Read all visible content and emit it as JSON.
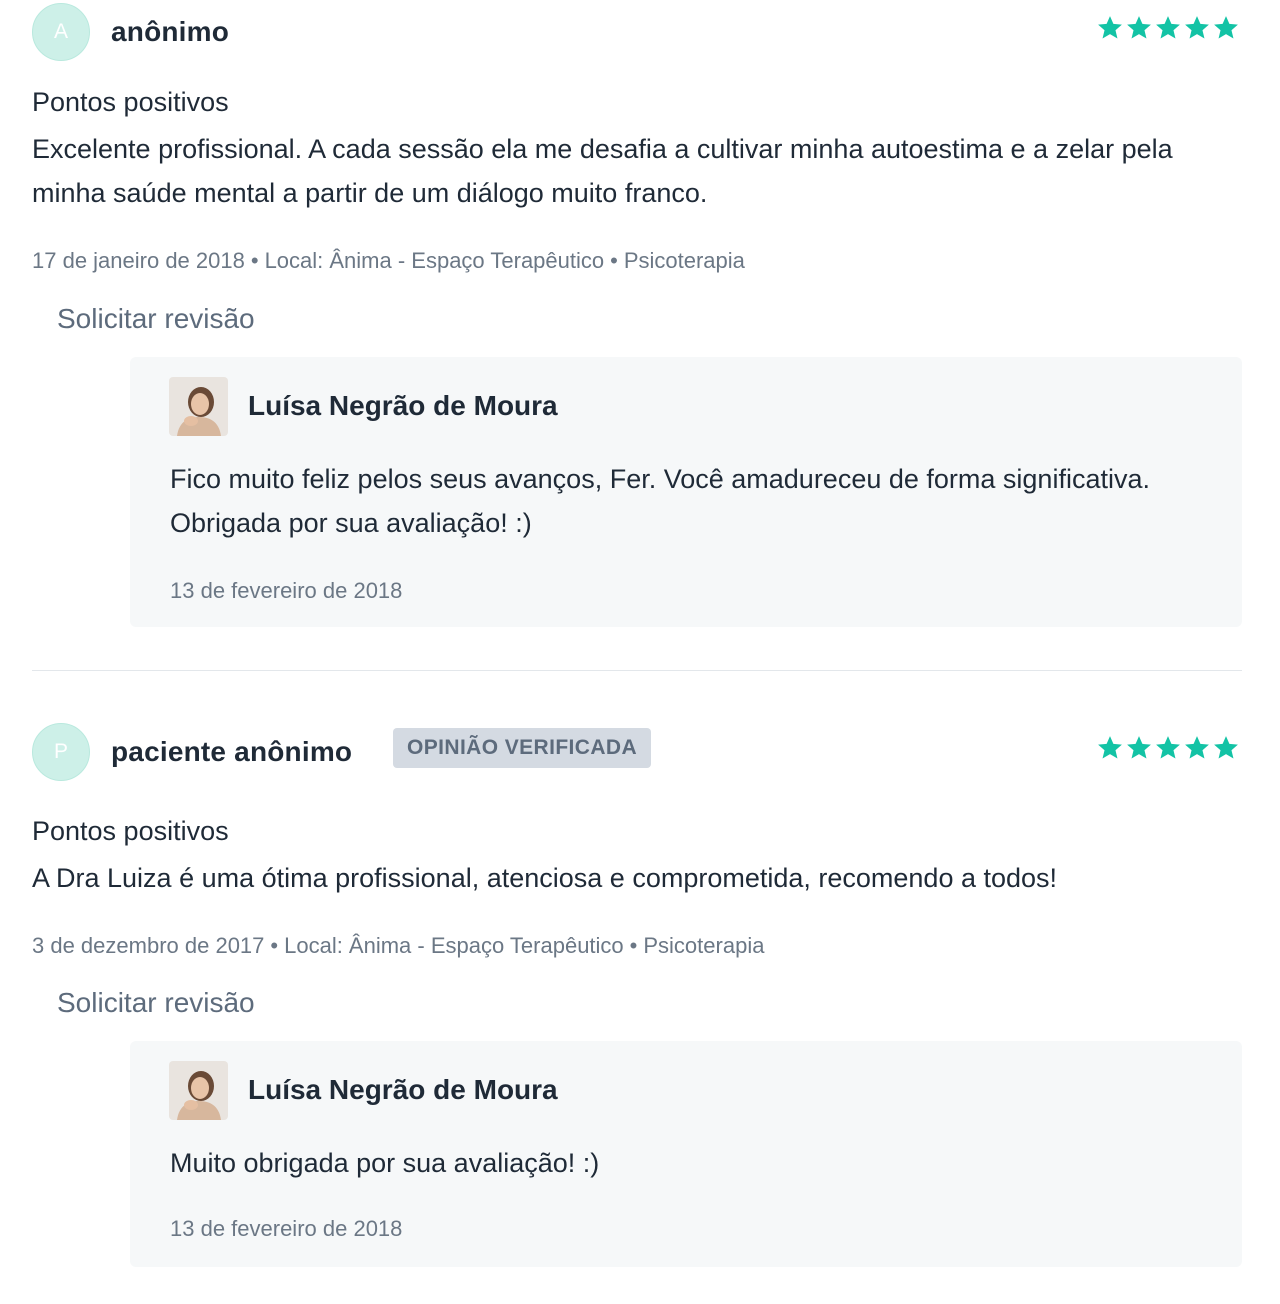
{
  "colors": {
    "star": "#13c3a5",
    "avatar_bg": "#cdf0e8",
    "badge_bg": "#d4dae2",
    "reply_bg": "#f6f8f9",
    "muted_text": "#6b7785"
  },
  "reviews": [
    {
      "avatar_initial": "A",
      "author": "anônimo",
      "badge": "",
      "rating": 5,
      "section_title": "Pontos positivos",
      "text": "Excelente profissional. A cada sessão ela me desafia a cultivar minha autoestima e a zelar pela minha saúde mental a partir de um diálogo muito franco.",
      "date": "17 de janeiro de 2018",
      "location": "Local: Ânima - Espaço Terapêutico",
      "service": "Psicoterapia",
      "request_review_label": "Solicitar revisão",
      "reply": {
        "author": "Luísa Negrão de Moura",
        "text": "Fico muito feliz pelos seus avanços, Fer. Você amadureceu de forma significativa. Obrigada por sua avaliação! :)",
        "date": "13 de fevereiro de 2018"
      }
    },
    {
      "avatar_initial": "P",
      "author": "paciente anônimo",
      "badge": "OPINIÃO VERIFICADA",
      "rating": 5,
      "section_title": "Pontos positivos",
      "text": "A Dra Luiza é uma ótima profissional, atenciosa e comprometida, recomendo a todos!",
      "date": "3 de dezembro de 2017",
      "location": "Local: Ânima - Espaço Terapêutico",
      "service": "Psicoterapia",
      "request_review_label": "Solicitar revisão",
      "reply": {
        "author": "Luísa Negrão de Moura",
        "text": "Muito obrigada por sua avaliação! :)",
        "date": "13 de fevereiro de 2018"
      }
    }
  ]
}
